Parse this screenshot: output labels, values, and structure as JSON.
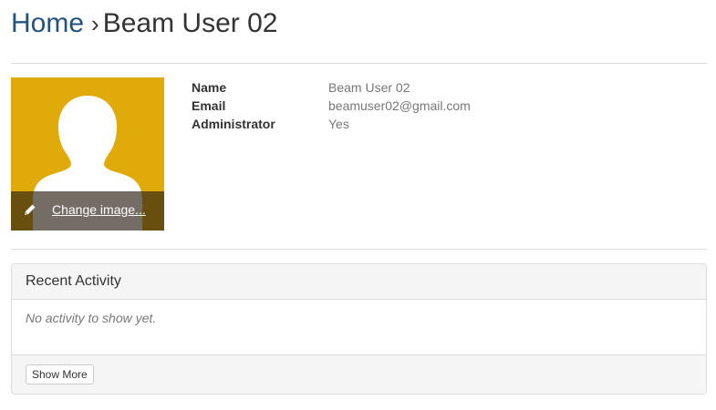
{
  "header": {
    "home_link": "Home",
    "separator": "›",
    "current_page": "Beam User 02"
  },
  "profile": {
    "avatar_icon": "user-silhouette-icon",
    "avatar_bg_color": "#dfaa0a",
    "change_image_icon": "pencil-icon",
    "change_image_label": "Change image..."
  },
  "details": [
    {
      "label": "Name",
      "value": "Beam User 02"
    },
    {
      "label": "Email",
      "value": "beamuser02@gmail.com"
    },
    {
      "label": "Administrator",
      "value": "Yes"
    }
  ],
  "recent_activity": {
    "title": "Recent Activity",
    "empty_message": "No activity to show yet.",
    "show_more_label": "Show More"
  },
  "colors": {
    "link": "#23527c",
    "muted_text": "#777777",
    "border": "#dddddd"
  }
}
